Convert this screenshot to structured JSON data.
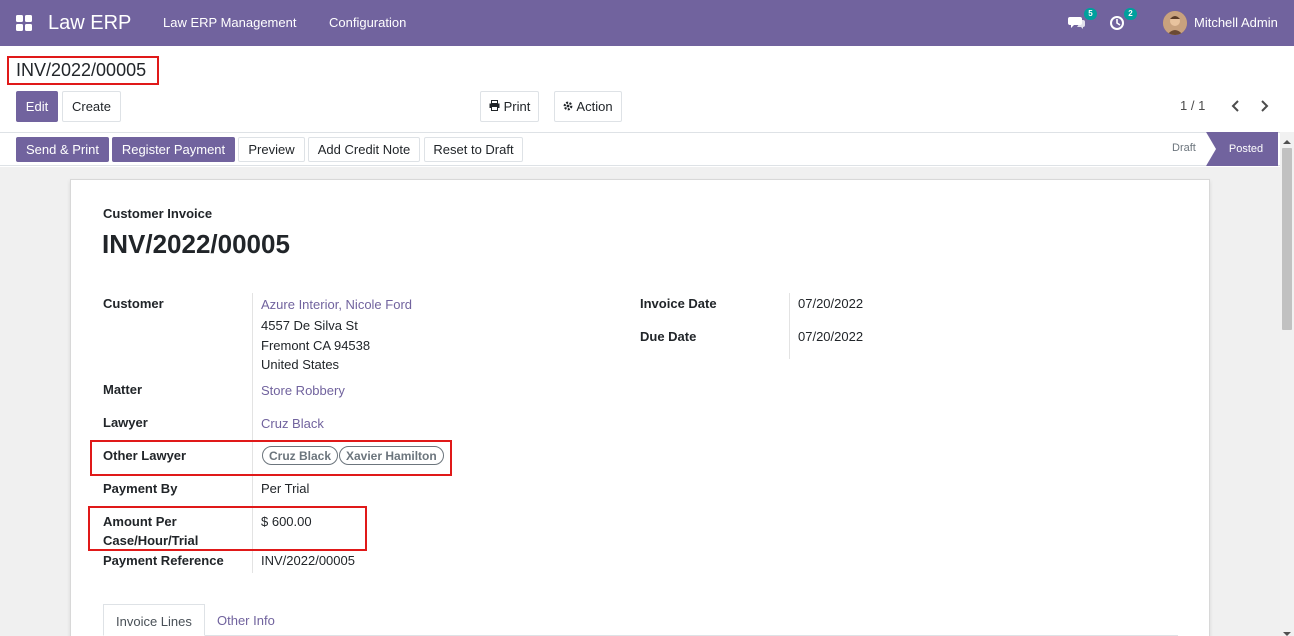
{
  "navbar": {
    "brand": "Law ERP",
    "menus": [
      "Law ERP Management",
      "Configuration"
    ],
    "messages_badge": "5",
    "activities_badge": "2",
    "user_name": "Mitchell Admin",
    "color": "#71639e"
  },
  "control_panel": {
    "breadcrumb": "INV/2022/00005",
    "edit_label": "Edit",
    "create_label": "Create",
    "print_label": "Print",
    "action_label": "Action",
    "pager": "1 / 1"
  },
  "statusbar": {
    "buttons": [
      "Send & Print",
      "Register Payment",
      "Preview",
      "Add Credit Note",
      "Reset to Draft"
    ],
    "stages": [
      "Draft",
      "Posted"
    ],
    "active_stage": "Posted"
  },
  "invoice": {
    "type_label": "Customer Invoice",
    "number": "INV/2022/00005",
    "fields": {
      "customer_label": "Customer",
      "customer_name": "Azure Interior, Nicole Ford",
      "address_line1": "4557 De Silva St",
      "address_line2": "Fremont CA 94538",
      "address_line3": "United States",
      "matter_label": "Matter",
      "matter_value": "Store Robbery",
      "lawyer_label": "Lawyer",
      "lawyer_value": "Cruz Black",
      "other_lawyer_label": "Other Lawyer",
      "other_lawyers": [
        "Cruz Black",
        "Xavier Hamilton"
      ],
      "payment_by_label": "Payment By",
      "payment_by_value": "Per Trial",
      "amount_label_line1": "Amount Per",
      "amount_label_line2": "Case/Hour/Trial",
      "amount_value": "$ 600.00",
      "payment_ref_label": "Payment Reference",
      "payment_ref_value": "INV/2022/00005",
      "invoice_date_label": "Invoice Date",
      "invoice_date_value": "07/20/2022",
      "due_date_label": "Due Date",
      "due_date_value": "07/20/2022"
    },
    "tabs": [
      "Invoice Lines",
      "Other Info"
    ],
    "active_tab": "Invoice Lines"
  },
  "colors": {
    "accent": "#71639e",
    "highlight": "#e01919"
  }
}
